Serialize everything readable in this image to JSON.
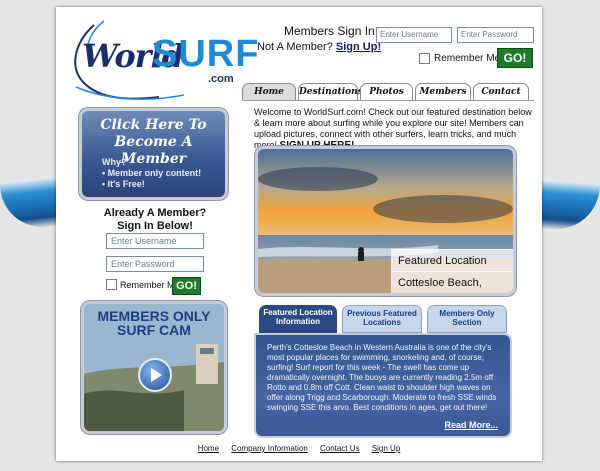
{
  "header": {
    "logo": {
      "world": "World",
      "surf": "SURF",
      "com": ".com"
    },
    "signin_title": "Members Sign In:",
    "not_member": "Not A Member?",
    "signup_link": "Sign Up!",
    "username_placeholder": "Enter Username",
    "password_placeholder": "Enter Password",
    "remember_me": "Remember Me",
    "go_label": "GO!"
  },
  "nav": {
    "tabs": [
      {
        "label": "Home",
        "active": true
      },
      {
        "label": "Destinations",
        "active": false
      },
      {
        "label": "Photos",
        "active": false
      },
      {
        "label": "Members",
        "active": false
      },
      {
        "label": "Contact",
        "active": false
      }
    ]
  },
  "sidebar": {
    "become": {
      "title_line1": "Click Here To",
      "title_line2": "Become A Member",
      "why": "Why?",
      "bullet1": "• Member only content!",
      "bullet2": "• It's Free!"
    },
    "already": {
      "line1": "Already A Member?",
      "line2": "Sign In Below!"
    },
    "username_placeholder": "Enter Username",
    "password_placeholder": "Enter Password",
    "remember_me": "Remember Me",
    "go_label": "GO!",
    "surfcam": {
      "line1": "MEMBERS ONLY",
      "line2": "SURF CAM"
    }
  },
  "main": {
    "welcome": "Welcome to WorldSurf.com! Check out our featured destination below & learn more about surfing while you explore our site! Members can upload pictures, connect with other surfers, learn tricks, and much more!",
    "signup_cta": "SIGN UP HERE!",
    "featured": {
      "label": "Featured Location",
      "location": "Cottesloe Beach, Perth"
    },
    "info_tabs": [
      {
        "label": "Featured Location Information",
        "active": true
      },
      {
        "label": "Previous Featured Locations",
        "active": false
      },
      {
        "label": "Members Only Section",
        "active": false
      }
    ],
    "info_text": "Perth's Cottesloe Beach in Western Australia is one of the city's most popular places for swimming, snorkeling and, of course, surfing!  Surf report for this week - The swell has come up dramatically overnight. The buoys are currently reading 2.5m off Rotto and 0.8m off Cott. Clean waist to shoulder high waves on offer along Trigg and Scarborough. Moderate to fresh SSE winds swinging SSE this arvo. Best conditions in ages, get out there!",
    "read_more": "Read More..."
  },
  "footer": {
    "links": [
      "Home",
      "Company Information",
      "Contact Us",
      "Sign Up"
    ]
  }
}
